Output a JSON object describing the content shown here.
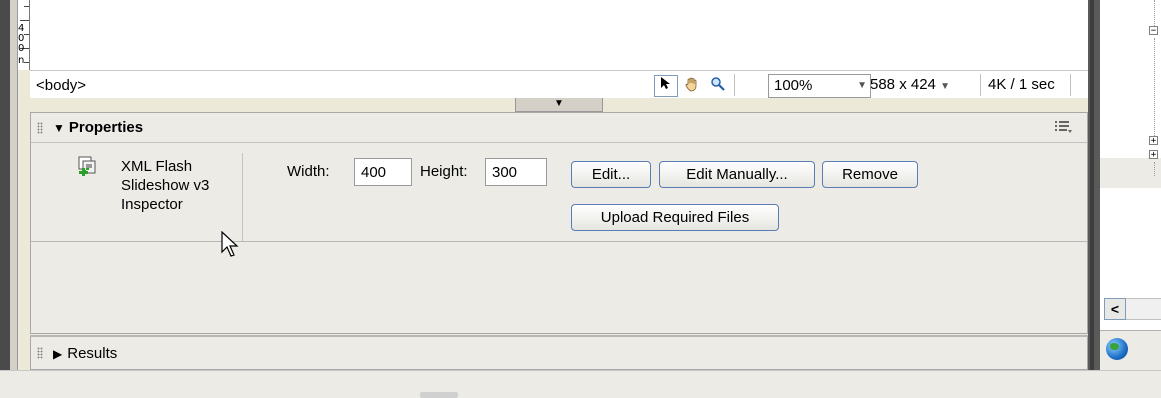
{
  "ruler": {
    "label_4": "4",
    "label_0": "0",
    "label_n": "n"
  },
  "status_bar": {
    "tag": "<body>",
    "zoom": "100%",
    "window_size": "588 x 424",
    "download": "4K / 1 sec",
    "tools": [
      "pointer-tool",
      "hand-tool",
      "zoom-tool"
    ]
  },
  "properties": {
    "title": "Properties",
    "extension_name": [
      "XML Flash",
      "Slideshow v3",
      "Inspector"
    ],
    "width_label": "Width:",
    "width_value": "400",
    "height_label": "Height:",
    "height_value": "300",
    "buttons": {
      "edit": "Edit...",
      "edit_manually": "Edit Manually...",
      "remove": "Remove",
      "upload": "Upload Required Files"
    }
  },
  "results": {
    "title": "Results"
  },
  "right_panel": {
    "tree_nodes": [
      "−",
      "+",
      "+"
    ],
    "scroll_left": "<"
  },
  "colors": {
    "panel_bg": "#ecebe6",
    "button_border": "#5a7db5",
    "frame_dark": "#4a4a4a"
  }
}
